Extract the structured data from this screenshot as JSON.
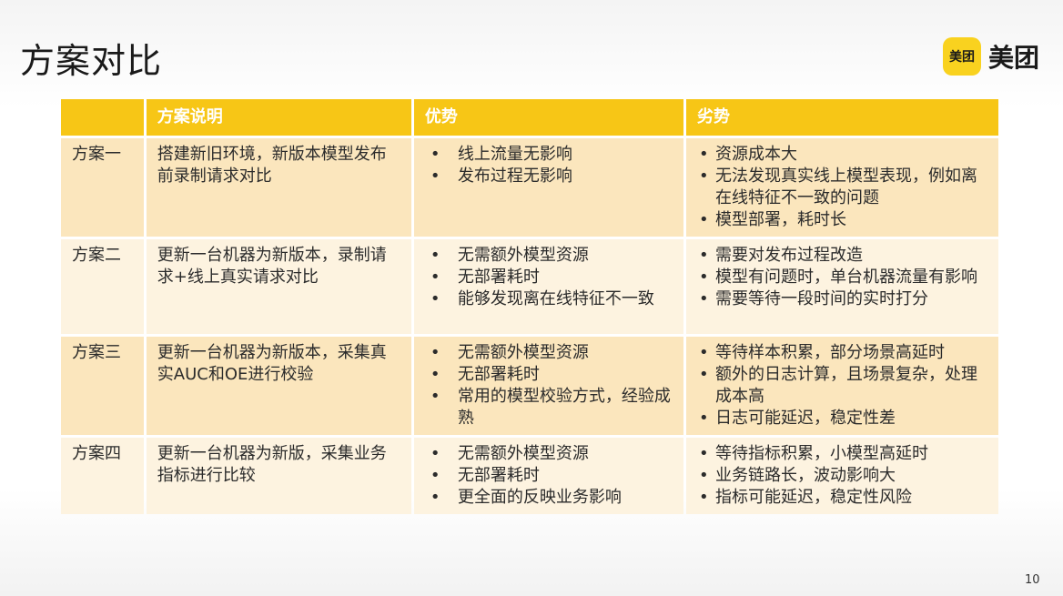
{
  "slide": {
    "title": "方案对比",
    "page_number": "10"
  },
  "logo": {
    "badge_text": "美团",
    "text": "美团"
  },
  "table": {
    "headers": [
      "",
      "方案说明",
      "优势",
      "劣势"
    ],
    "rows": [
      {
        "name": "方案一",
        "desc": "搭建新旧环境，新版本模型发布前录制请求对比",
        "advantages": [
          "线上流量无影响",
          "发布过程无影响"
        ],
        "disadvantages": [
          "资源成本大",
          "无法发现真实线上模型表现，例如离在线特征不一致的问题",
          "模型部署，耗时长"
        ]
      },
      {
        "name": "方案二",
        "desc": "更新一台机器为新版本，录制请求+线上真实请求对比",
        "advantages": [
          "无需额外模型资源",
          "无部署耗时",
          "能够发现离在线特征不一致"
        ],
        "disadvantages": [
          "需要对发布过程改造",
          "模型有问题时，单台机器流量有影响",
          "需要等待一段时间的实时打分"
        ]
      },
      {
        "name": "方案三",
        "desc": "更新一台机器为新版本，采集真实AUC和OE进行校验",
        "advantages": [
          "无需额外模型资源",
          "无部署耗时",
          "常用的模型校验方式，经验成熟"
        ],
        "disadvantages": [
          "等待样本积累，部分场景高延时",
          "额外的日志计算，且场景复杂，处理成本高",
          "日志可能延迟，稳定性差"
        ]
      },
      {
        "name": "方案四",
        "desc": "更新一台机器为新版，采集业务指标进行比较",
        "advantages": [
          "无需额外模型资源",
          "无部署耗时",
          "更全面的反映业务影响"
        ],
        "disadvantages": [
          "等待指标积累，小模型高延时",
          "业务链路长，波动影响大",
          "指标可能延迟，稳定性风险"
        ]
      }
    ]
  },
  "colors": {
    "header_bg": "#f7c616",
    "row_dark": "#fbe6bd",
    "row_light": "#fdf3e0",
    "brand_yellow": "#f9d21f"
  }
}
